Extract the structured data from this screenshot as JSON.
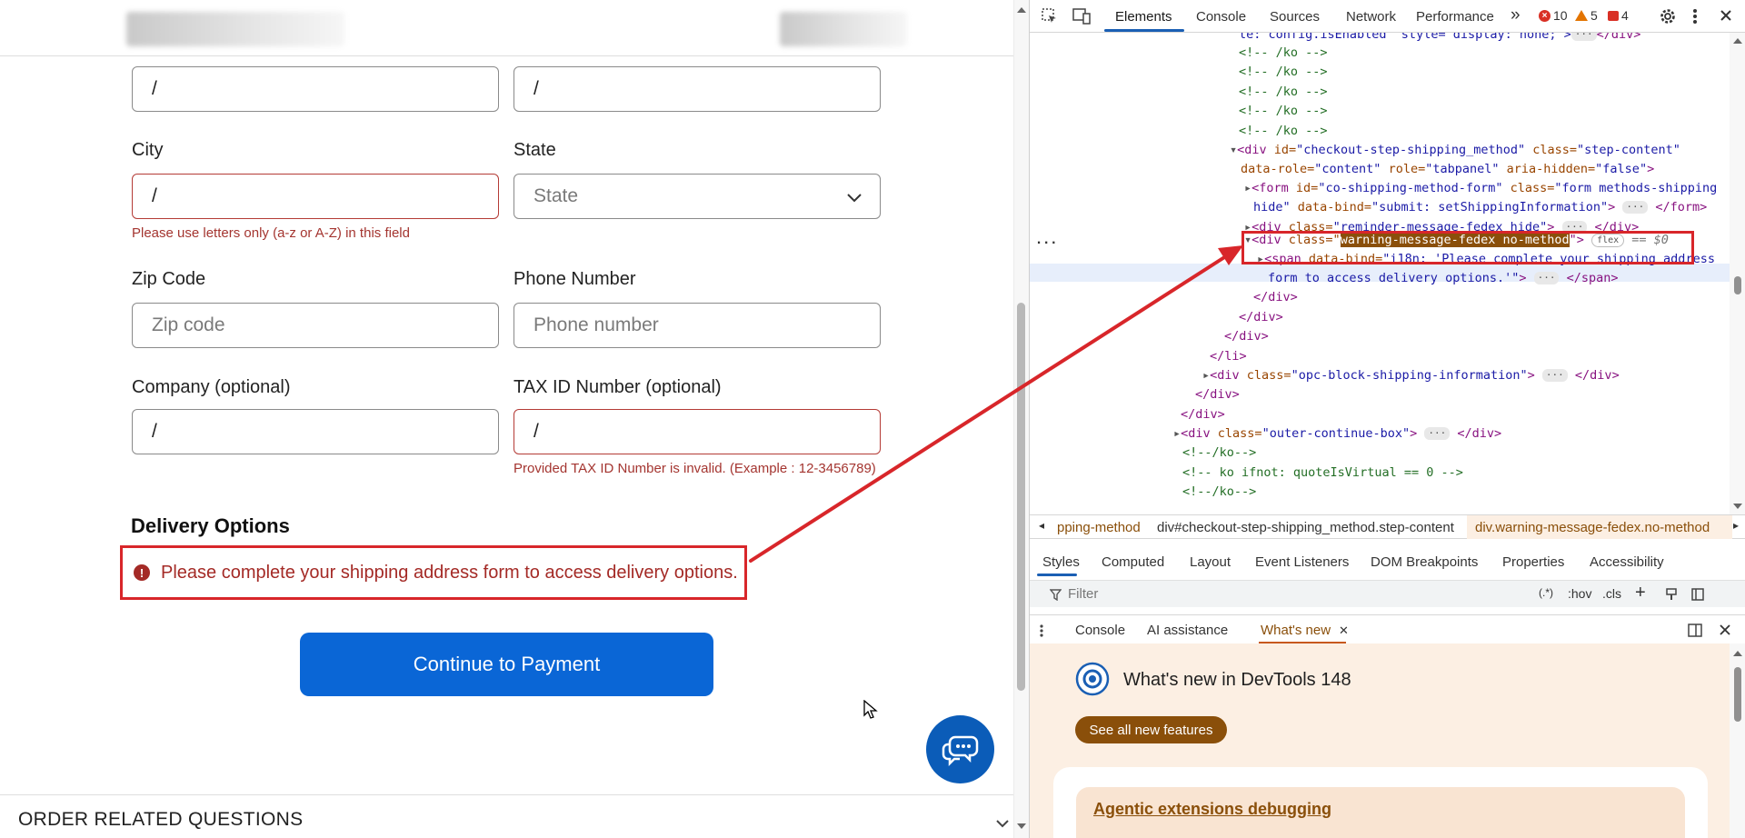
{
  "form": {
    "row1": {
      "left_value": "/",
      "right_value": "/"
    },
    "city": {
      "label": "City",
      "value": "/",
      "error": "Please use letters only (a-z or A-Z) in this field"
    },
    "state": {
      "label": "State",
      "placeholder": "State"
    },
    "zip": {
      "label": "Zip Code",
      "placeholder": "Zip code"
    },
    "phone": {
      "label": "Phone Number",
      "placeholder": "Phone number"
    },
    "company": {
      "label": "Company (optional)",
      "value": "/"
    },
    "tax": {
      "label": "TAX ID Number (optional)",
      "value": "/",
      "error": "Provided TAX ID Number is invalid. (Example : 12-3456789)"
    }
  },
  "delivery": {
    "title": "Delivery Options",
    "warning_icon": "!",
    "warning": "Please complete your shipping address form to access delivery options."
  },
  "continue_label": "Continue to Payment",
  "footer": {
    "order_questions": "ORDER RELATED QUESTIONS"
  },
  "devtools": {
    "tabs": [
      "Elements",
      "Console",
      "Sources",
      "Network",
      "Performance"
    ],
    "more": "»",
    "errors": "10",
    "warnings": "5",
    "issues": "4",
    "dom_lines": {
      "l0": "le: config.isEnabled\" style=\"display: none;\">",
      "l0_end": "</div>",
      "ko": "<!-- /ko -->",
      "step_open_a": "<div ",
      "step_id_attr": "id=",
      "step_id_val": "\"checkout-step-shipping_method\"",
      "step_class_attr": " class=",
      "step_class_val": "\"step-content\"",
      "step_line2_a": "data-role=",
      "step_line2_b": "\"content\"",
      "step_line2_c": " role=",
      "step_line2_d": "\"tabpanel\"",
      "step_line2_e": " aria-hidden=",
      "step_line2_f": "\"false\"",
      "step_line2_g": ">",
      "form_a": "<form ",
      "form_b": "id=",
      "form_c": "\"co-shipping-method-form\"",
      "form_d": " class=",
      "form_e": "\"form methods-shipping",
      "form_f": "hide\"",
      "form_g": " data-bind=",
      "form_h": "\"submit: setShippingInformation\"",
      "form_i": "> ",
      "form_j": " </form>",
      "rem_a": "<div ",
      "rem_b": "class=",
      "rem_c": "\"reminder-message-fedex hide\"",
      "rem_d": "> ",
      "rem_e": " </div>",
      "sel_a": "<div ",
      "sel_b": "class=\"",
      "sel_c": "warning-message-fedex no-method",
      "sel_d": "\">",
      "sel_flex": "flex",
      "sel_dollar": "== $0",
      "span_a": "<span ",
      "span_b": "data-bind=",
      "span_c": "\"i18n: 'Please complete your shipping address",
      "span_d": "form to access delivery options.'\"",
      "span_e": "> ",
      "span_f": " </span>",
      "close_div": "</div>",
      "close_li": "</li>",
      "opc_a": "<div ",
      "opc_b": "class=",
      "opc_c": "\"opc-block-shipping-information\"",
      "opc_d": "> ",
      "opc_e": " </div>",
      "outer_a": "<div ",
      "outer_b": "class=",
      "outer_c": "\"outer-continue-box\"",
      "outer_d": "> ",
      "outer_e": " </div>",
      "ko_end": "<!--/ko-->",
      "ko_ifnot": "<!-- ko ifnot: quoteIsVirtual == 0 -->",
      "ko_end2": "<!--/ko-->",
      "ellipsis": "···",
      "gutter_dots": "..."
    },
    "crumbs": {
      "c1": "pping-method",
      "c2": "div#checkout-step-shipping_method.step-content",
      "c3": "div.warning-message-fedex.no-method"
    },
    "style_tabs": [
      "Styles",
      "Computed",
      "Layout",
      "Event Listeners",
      "DOM Breakpoints",
      "Properties",
      "Accessibility"
    ],
    "filter_placeholder": "Filter",
    "filter_right": {
      "regex": "(.*)",
      "hov": ":hov",
      "cls": ".cls"
    },
    "drawer_tabs": {
      "console": "Console",
      "ai": "AI assistance",
      "whats_new": "What's new",
      "close": "✕"
    },
    "whats_new": {
      "title": "What's new in DevTools 148",
      "button": "See all new features",
      "card_title": "Agentic extensions debugging"
    }
  },
  "colors": {
    "accent_blue": "#0a66d6",
    "error_red": "#a42a26",
    "annotation_red": "#d8262a",
    "devtools_highlight": "#8a4f0a"
  },
  "icons": {
    "inspect": "inspect-icon",
    "device": "device-toolbar-icon",
    "settings": "gear-icon",
    "menu": "kebab-menu-icon",
    "chat": "chat-bubble-icon"
  }
}
